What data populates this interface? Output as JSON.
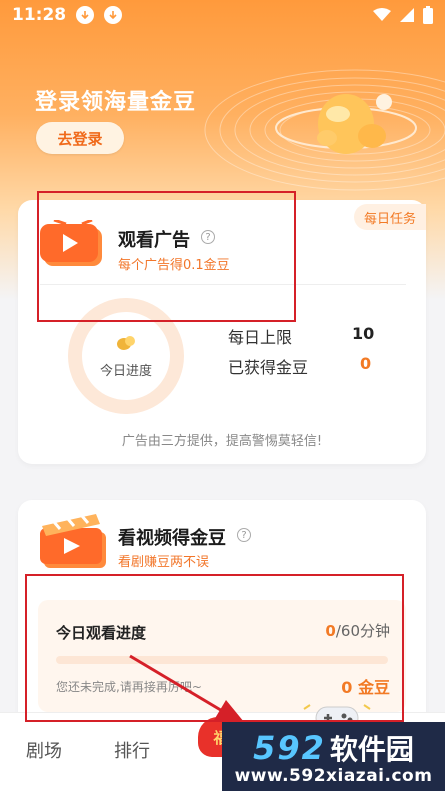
{
  "status_bar": {
    "time": "11:28"
  },
  "promo": {
    "title": "登录领海量金豆",
    "login_button": "去登录"
  },
  "ad_task": {
    "badge": "每日任务",
    "title": "观看广告",
    "subtitle": "每个广告得0.1金豆",
    "progress_label": "今日进度",
    "daily_limit_label": "每日上限",
    "daily_limit_value": "10",
    "earned_label": "已获得金豆",
    "earned_value": "0",
    "tip": "广告由三方提供，提高警惕莫轻信!"
  },
  "video_task": {
    "title": "看视频得金豆",
    "subtitle": "看剧赚豆两不误",
    "progress_title": "今日观看进度",
    "progress_current": "0",
    "progress_total": "/60分钟",
    "progress_fraction": 0,
    "hint": "您还未完成,请再接再厉吧~",
    "reward": "0 金豆"
  },
  "bottom_nav": {
    "item1": "剧场",
    "item2": "排行",
    "center_label": "福"
  },
  "watermark": {
    "brand_num": "592",
    "brand_cn": "软件园",
    "url": "www.592xiazai.com"
  },
  "colors": {
    "accent": "#f27a25",
    "annotation_red": "#d52028",
    "watermark_bg": "#1f2a47"
  }
}
